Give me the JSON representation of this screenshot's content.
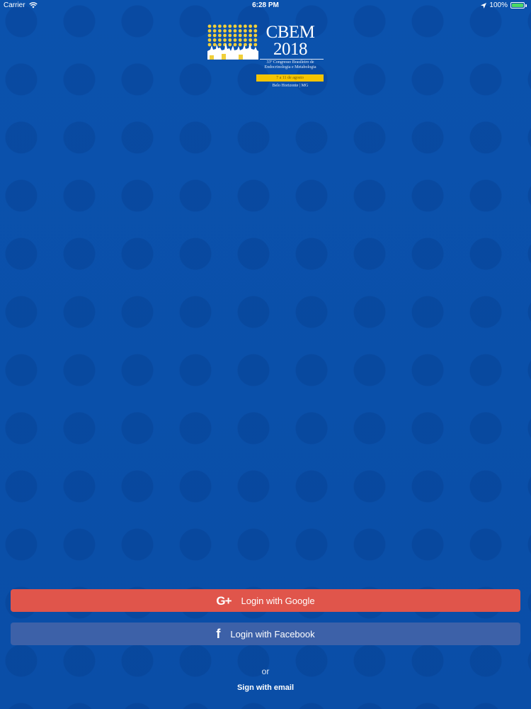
{
  "status_bar": {
    "carrier": "Carrier",
    "time": "6:28 PM",
    "battery_percent": "100%",
    "battery_level": 1.0,
    "battery_color": "#4cd964"
  },
  "logo": {
    "title_line1": "CBEM",
    "title_line2": "2018",
    "subtitle": "33º Congresso Brasileiro de Endocrinologia e Metabologia",
    "dates": "7 a 11 de agosto",
    "location": "Belo Horizonte | MG",
    "accent_color": "#f4c400"
  },
  "auth": {
    "google_label": "Login with Google",
    "google_icon_text": "G+",
    "facebook_label": "Login with Facebook",
    "facebook_icon_text": "f",
    "or_text": "or",
    "email_label": "Sign with email"
  },
  "colors": {
    "background": "#0b4fa8",
    "google_button": "#e0554b",
    "facebook_button": "#3d61a8"
  },
  "icons": [
    "wifi-icon",
    "location-arrow-icon",
    "battery-icon",
    "google-plus-icon",
    "facebook-icon"
  ]
}
